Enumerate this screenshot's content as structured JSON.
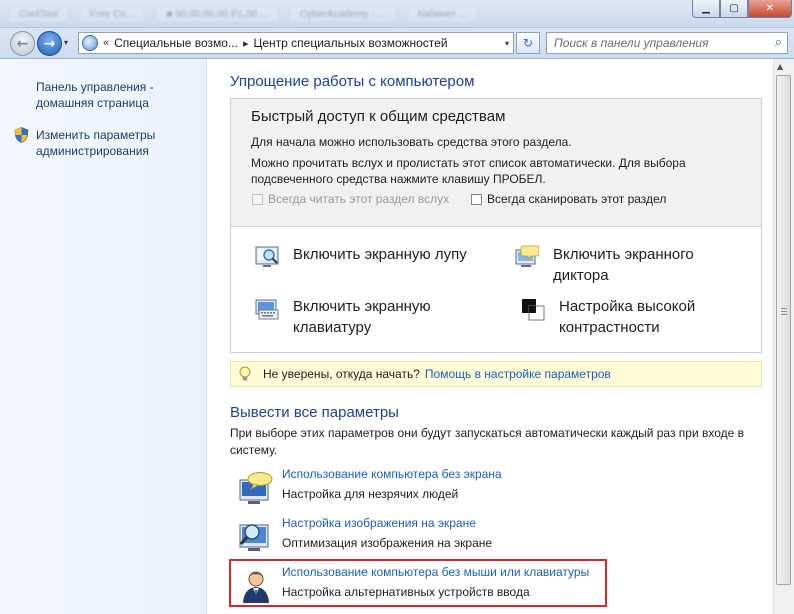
{
  "titlebar": {
    "ghost_tabs": [
      "CoolTool",
      "Free Co...",
      "■ 90,00,00,00 P1,00 ...",
      "CyberAcademy - ...",
      "Кабинет ..."
    ],
    "controls": {
      "minimize": "▁",
      "maximize": "▢",
      "close": "✕"
    }
  },
  "address": {
    "overflow": "«",
    "crumb1": "Специальные возмо...",
    "separator": "▸",
    "crumb2": "Центр специальных возможностей",
    "dropdown": "▾",
    "back_glyph": "←",
    "forward_glyph": "→",
    "refresh_glyph": "↻"
  },
  "search": {
    "placeholder": "Поиск в панели управления",
    "icon": "⌕"
  },
  "sidebar": {
    "home_line1": "Панель управления -",
    "home_line2": "домашняя страница",
    "admin_line1": "Изменить параметры",
    "admin_line2": "администрирования"
  },
  "main": {
    "heading": "Упрощение работы с компьютером",
    "quick": {
      "title": "Быстрый доступ к общим средствам",
      "text1": "Для начала можно использовать средства этого раздела.",
      "text2_line1": "Можно прочитать вслух и пролистать этот список автоматически. Для выбора",
      "text2_line2": "подсвеченного средства нажмите клавишу ПРОБЕЛ.",
      "check_read": {
        "label": "Всегда читать этот раздел вслух",
        "checked": false,
        "enabled": false
      },
      "check_scan": {
        "label": "Всегда сканировать этот раздел",
        "checked": false,
        "enabled": true
      }
    },
    "tools": {
      "magnifier": {
        "line1": "Включить экранную лупу",
        "line2": ""
      },
      "narrator": {
        "line1": "Включить экранного",
        "line2": "диктора"
      },
      "keyboard": {
        "line1": "Включить экранную",
        "line2": "клавиатуру"
      },
      "contrast": {
        "line1": "Настройка высокой",
        "line2": "контрастности"
      }
    },
    "tip": {
      "text": "Не уверены, откуда начать?",
      "link": "Помощь в настройке параметров"
    },
    "all_settings": {
      "heading": "Вывести все параметры",
      "text": "При выборе этих параметров они будут запускаться автоматически каждый раз при входе в систему."
    },
    "options": [
      {
        "link": "Использование компьютера без экрана",
        "desc": "Настройка для незрячих людей"
      },
      {
        "link": "Настройка изображения на экране",
        "desc": "Оптимизация изображения на экране"
      },
      {
        "link": "Использование компьютера без мыши или клавиатуры",
        "desc": "Настройка альтернативных устройств ввода"
      }
    ]
  },
  "colors": {
    "link": "#1a5fbf",
    "heading": "#1e3f9a",
    "highlight_border": "#d42a2f",
    "tip_background": "#fdfbd6"
  }
}
